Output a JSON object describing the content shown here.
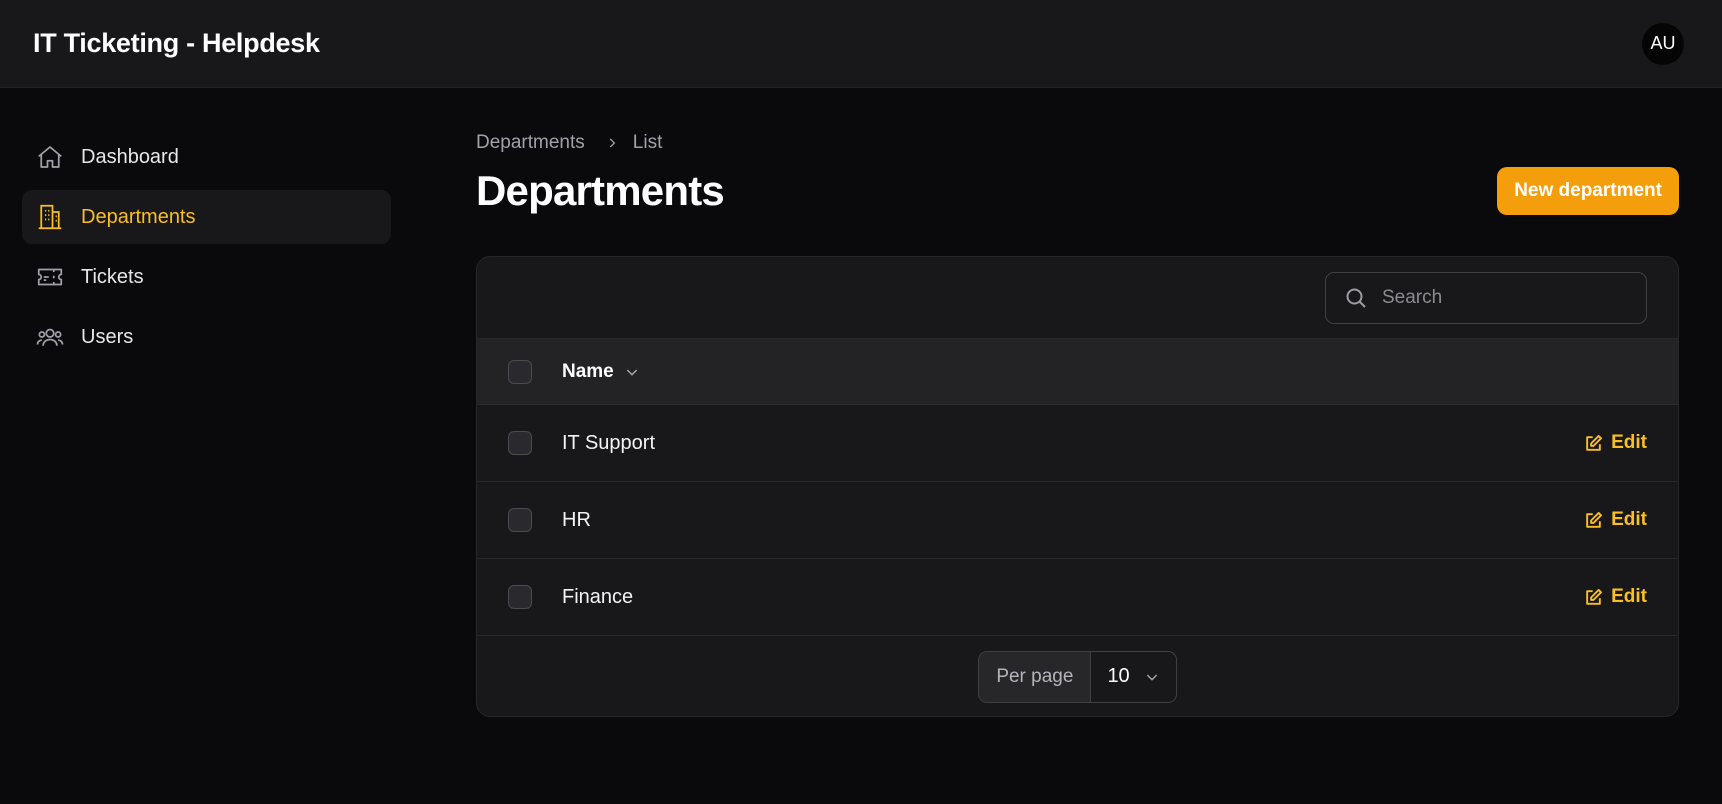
{
  "app": {
    "title": "IT Ticketing - Helpdesk",
    "avatar_initials": "AU"
  },
  "colors": {
    "accent": "#f59e0b",
    "accent_text": "#fbbf24",
    "background": "#0a0a0c",
    "surface": "#18181b"
  },
  "sidebar": {
    "items": [
      {
        "label": "Dashboard",
        "icon": "home-icon",
        "active": false
      },
      {
        "label": "Departments",
        "icon": "building-icon",
        "active": true
      },
      {
        "label": "Tickets",
        "icon": "ticket-icon",
        "active": false
      },
      {
        "label": "Users",
        "icon": "users-icon",
        "active": false
      }
    ]
  },
  "breadcrumb": {
    "parent": "Departments",
    "current": "List"
  },
  "page": {
    "title": "Departments",
    "new_button_label": "New department"
  },
  "table": {
    "search_placeholder": "Search",
    "columns": [
      {
        "label": "Name",
        "sortable": true
      }
    ],
    "rows": [
      {
        "name": "IT Support",
        "action": "Edit"
      },
      {
        "name": "HR",
        "action": "Edit"
      },
      {
        "name": "Finance",
        "action": "Edit"
      }
    ],
    "pagination": {
      "per_page_label": "Per page",
      "per_page_value": "10"
    }
  }
}
